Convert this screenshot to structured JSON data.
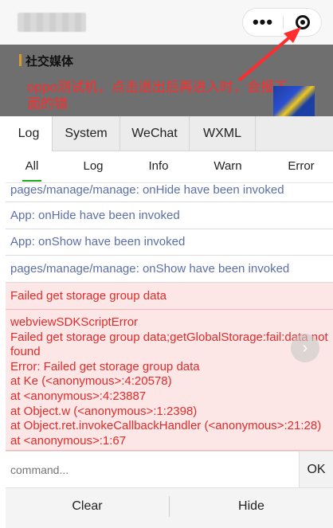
{
  "capsule": {
    "menu_icon": "more-dots-icon",
    "close_icon": "target-close-icon",
    "menu_glyph": "•••"
  },
  "background": {
    "section_title": "社交媒体",
    "annotation": "oppo测试机，点击退出后再进入时，会报下面的错",
    "annotation_color": "#ff2d2d"
  },
  "tabs": [
    {
      "label": "Log"
    },
    {
      "label": "System"
    },
    {
      "label": "WeChat"
    },
    {
      "label": "WXML"
    }
  ],
  "filters": [
    {
      "label": "All"
    },
    {
      "label": "Log"
    },
    {
      "label": "Info"
    },
    {
      "label": "Warn"
    },
    {
      "label": "Error"
    }
  ],
  "logs": [
    {
      "level": "info",
      "lines": [
        "pages/manage/manage: onHide have been invoked"
      ]
    },
    {
      "level": "info",
      "lines": [
        "App: onHide have been invoked"
      ]
    },
    {
      "level": "info",
      "lines": [
        "App: onShow have been invoked"
      ]
    },
    {
      "level": "info",
      "lines": [
        "pages/manage/manage: onShow have been invoked"
      ]
    },
    {
      "level": "error",
      "lines": [
        "Failed get storage group data"
      ]
    },
    {
      "level": "error",
      "lines": [
        "webviewSDKScriptError",
        "Failed get storage group data;getGlobalStorage:fail:data not found",
        "Error: Failed get storage group data",
        "at Ke (<anonymous>:4:20578)",
        "at <anonymous>:4:23887",
        "at Object.w (<anonymous>:1:2398)",
        "at Object.ret.invokeCallbackHandler (<anonymous>:21:28)",
        "at <anonymous>:1:67"
      ]
    }
  ],
  "command": {
    "placeholder": "command...",
    "ok_label": "OK"
  },
  "bottom": {
    "clear_label": "Clear",
    "hide_label": "Hide"
  },
  "colors": {
    "info_text": "#5b6fa8",
    "error_text": "#e12b2b",
    "error_bg": "#fde6e6",
    "accent": "#1aad19"
  }
}
